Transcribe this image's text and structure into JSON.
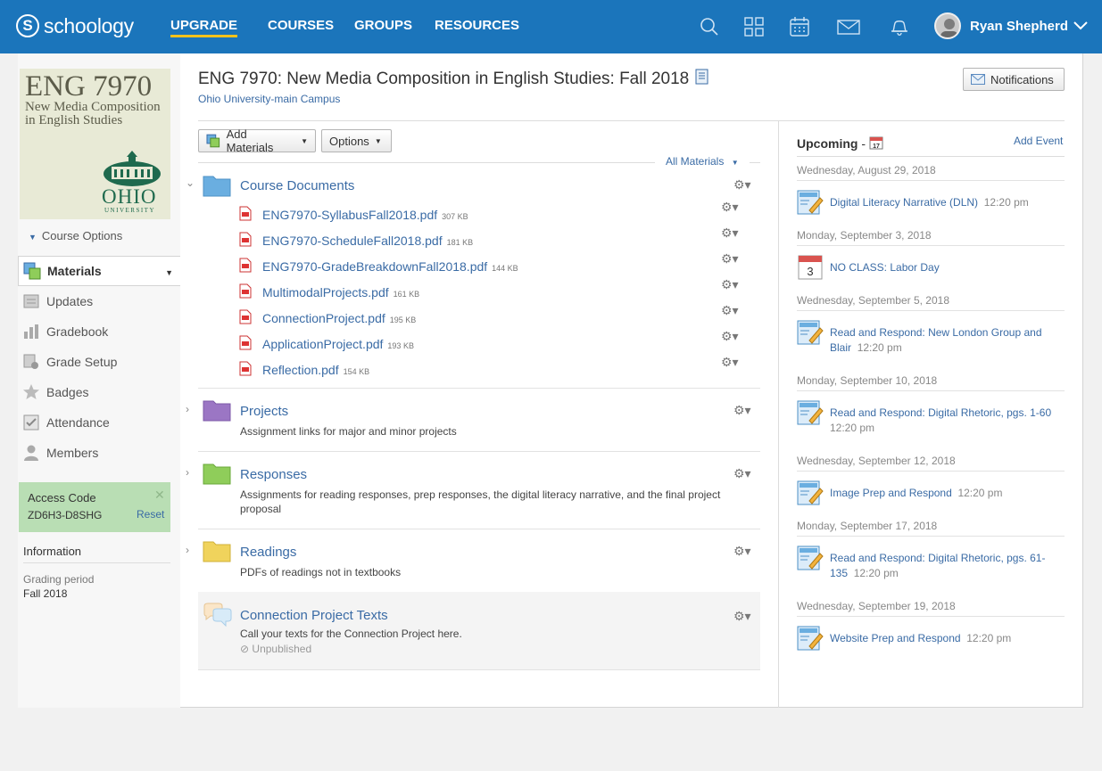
{
  "topbar": {
    "logo_text": "schoology",
    "nav": [
      "UPGRADE",
      "COURSES",
      "GROUPS",
      "RESOURCES"
    ],
    "user_name": "Ryan Shepherd"
  },
  "sidebar": {
    "image_title": "ENG 7970",
    "image_subtitle": "New Media Composition in English Studies",
    "image_ohio": "OHIO",
    "image_university": "UNIVERSITY",
    "course_options": "Course Options",
    "items": [
      {
        "label": "Materials"
      },
      {
        "label": "Updates"
      },
      {
        "label": "Gradebook"
      },
      {
        "label": "Grade Setup"
      },
      {
        "label": "Badges"
      },
      {
        "label": "Attendance"
      },
      {
        "label": "Members"
      }
    ],
    "access_code_title": "Access Code",
    "access_code": "ZD6H3-D8SHG",
    "reset": "Reset",
    "information": "Information",
    "grading_period_label": "Grading period",
    "grading_period_value": "Fall 2018"
  },
  "header": {
    "title": "ENG 7970: New Media Composition in English Studies: Fall 2018",
    "campus": "Ohio University-main Campus",
    "notifications": "Notifications"
  },
  "toolbar": {
    "add_materials": "Add Materials",
    "options": "Options",
    "all_materials": "All Materials"
  },
  "folders": [
    {
      "title": "Course Documents",
      "color": "#6aaee0",
      "files": [
        {
          "name": "ENG7970-SyllabusFall2018.pdf",
          "size": "307 KB"
        },
        {
          "name": "ENG7970-ScheduleFall2018.pdf",
          "size": "181 KB"
        },
        {
          "name": "ENG7970-GradeBreakdownFall2018.pdf",
          "size": "144 KB"
        },
        {
          "name": "MultimodalProjects.pdf",
          "size": "161 KB"
        },
        {
          "name": "ConnectionProject.pdf",
          "size": "195 KB"
        },
        {
          "name": "ApplicationProject.pdf",
          "size": "193 KB"
        },
        {
          "name": "Reflection.pdf",
          "size": "154 KB"
        }
      ]
    },
    {
      "title": "Projects",
      "desc": "Assignment links for major and minor projects",
      "color": "#9b76c4"
    },
    {
      "title": "Responses",
      "desc": "Assignments for reading responses, prep responses, the digital literacy narrative, and the final project proposal",
      "color": "#8fcd5a"
    },
    {
      "title": "Readings",
      "desc": "PDFs of readings not in textbooks",
      "color": "#f0d35c"
    },
    {
      "title": "Connection Project Texts",
      "desc": "Call your texts for the Connection Project here.",
      "status": "Unpublished"
    }
  ],
  "upcoming": {
    "title": "Upcoming",
    "add_event": "Add Event",
    "calendar_icon_day": "17",
    "labor_day_number": "3",
    "groups": [
      {
        "date": "Wednesday, August 29, 2018",
        "events": [
          {
            "name": "Digital Literacy Narrative (DLN)",
            "time": "12:20 pm"
          }
        ]
      },
      {
        "date": "Monday, September 3, 2018",
        "events": [
          {
            "name": "NO CLASS: Labor Day",
            "time": ""
          }
        ]
      },
      {
        "date": "Wednesday, September 5, 2018",
        "events": [
          {
            "name": "Read and Respond: New London Group and Blair",
            "time": "12:20 pm"
          }
        ]
      },
      {
        "date": "Monday, September 10, 2018",
        "events": [
          {
            "name": "Read and Respond: Digital Rhetoric, pgs. 1-60",
            "time": "12:20 pm"
          }
        ]
      },
      {
        "date": "Wednesday, September 12, 2018",
        "events": [
          {
            "name": "Image Prep and Respond",
            "time": "12:20 pm"
          }
        ]
      },
      {
        "date": "Monday, September 17, 2018",
        "events": [
          {
            "name": "Read and Respond: Digital Rhetoric, pgs. 61-135",
            "time": "12:20 pm"
          }
        ]
      },
      {
        "date": "Wednesday, September 19, 2018",
        "events": [
          {
            "name": "Website Prep and Respond",
            "time": "12:20 pm"
          }
        ]
      }
    ]
  }
}
